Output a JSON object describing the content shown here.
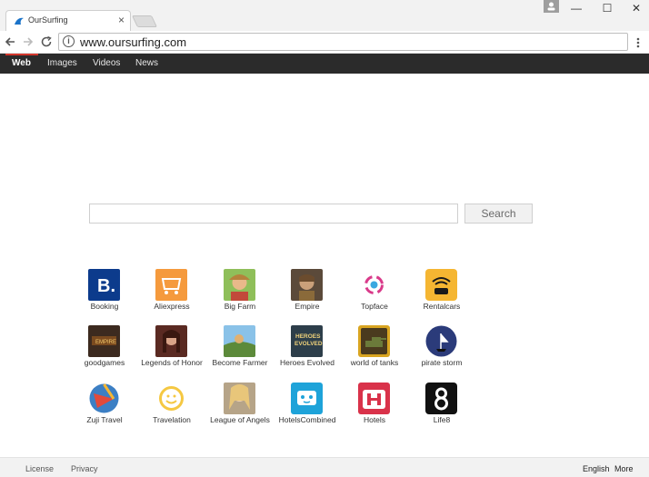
{
  "browser": {
    "tab_title": "OurSurfing",
    "tab_close": "×",
    "url": "www.oursurfing.com",
    "window_minimize": "—",
    "window_maximize": "☐",
    "window_close": "✕"
  },
  "nav": {
    "items": [
      {
        "label": "Web",
        "active": true
      },
      {
        "label": "Images"
      },
      {
        "label": "Videos"
      },
      {
        "label": "News"
      }
    ]
  },
  "search": {
    "placeholder": "",
    "button_label": "Search"
  },
  "tiles": [
    {
      "label": "Booking",
      "icon": "booking-icon",
      "color": "#0c3b8c"
    },
    {
      "label": "Aliexpress",
      "icon": "aliexpress-icon",
      "color": "#f59a3d"
    },
    {
      "label": "Big Farm",
      "icon": "big-farm-icon",
      "color": "#b5823c"
    },
    {
      "label": "Empire",
      "icon": "empire-icon",
      "color": "#5b4a3a"
    },
    {
      "label": "Topface",
      "icon": "topface-icon",
      "color": "#ffffff"
    },
    {
      "label": "Rentalcars",
      "icon": "rentalcars-icon",
      "color": "#f5b632"
    },
    {
      "label": "goodgames",
      "icon": "goodgames-icon",
      "color": "#3c2a1f"
    },
    {
      "label": "Legends of Honor",
      "icon": "legends-of-honor-icon",
      "color": "#5a2a22"
    },
    {
      "label": "Become Farmer",
      "icon": "become-farmer-icon",
      "color": "#5c8a3a"
    },
    {
      "label": "Heroes Evolved",
      "icon": "heroes-evolved-icon",
      "color": "#2d3e4a"
    },
    {
      "label": "world of tanks",
      "icon": "world-of-tanks-icon",
      "color": "#d9a521"
    },
    {
      "label": "pirate storm",
      "icon": "pirate-storm-icon",
      "color": "#2b3b7a"
    },
    {
      "label": "Zuji Travel",
      "icon": "zuji-travel-icon",
      "color": "#e6eef7"
    },
    {
      "label": "Travelation",
      "icon": "travelation-icon",
      "color": "#ffffff"
    },
    {
      "label": "League of Angels",
      "icon": "league-of-angels-icon",
      "color": "#7a6a55"
    },
    {
      "label": "HotelsCombined",
      "icon": "hotelscombined-icon",
      "color": "#1ea3d9"
    },
    {
      "label": "Hotels",
      "icon": "hotels-icon",
      "color": "#d9324a"
    },
    {
      "label": "Life8",
      "icon": "life8-icon",
      "color": "#111111"
    }
  ],
  "footer": {
    "license": "License",
    "privacy": "Privacy",
    "language": "English",
    "more": "More"
  }
}
